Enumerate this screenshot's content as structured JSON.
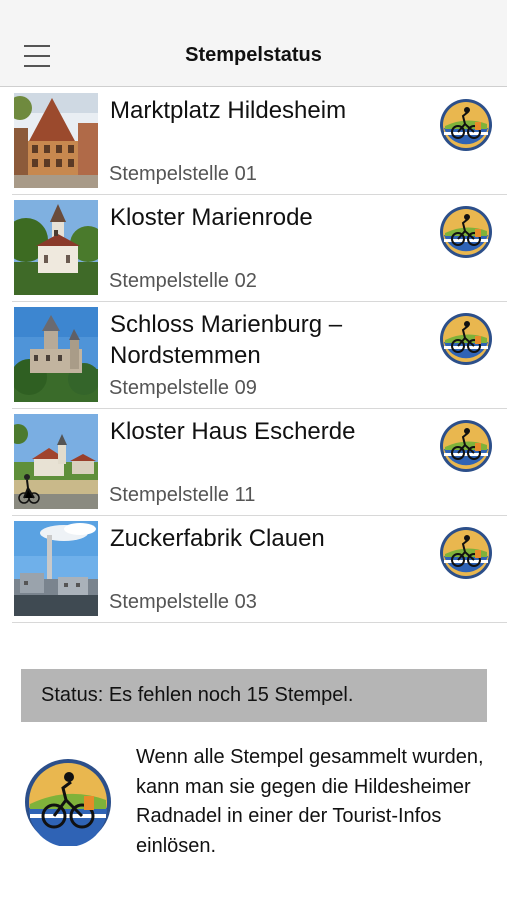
{
  "navbar": {
    "title": "Stempelstatus",
    "menu_icon": "hamburger-menu-icon"
  },
  "stations": [
    {
      "title": "Marktplatz Hildesheim",
      "subtitle": "Stempelstelle 01",
      "image": "half-timbered-market-square"
    },
    {
      "title": "Kloster Marienrode",
      "subtitle": "Stempelstelle 02",
      "image": "monastery-church"
    },
    {
      "title": "Schloss Marienburg – Nordstemmen",
      "subtitle": "Stempelstelle 09",
      "image": "castle-on-hill"
    },
    {
      "title": "Kloster Haus Escherde",
      "subtitle": "Stempelstelle 11",
      "image": "village-with-cyclist"
    },
    {
      "title": "Zuckerfabrik Clauen",
      "subtitle": "Stempelstelle 03",
      "image": "sugar-factory-chimney"
    }
  ],
  "stamp_icon": "cyclist-stamp-icon",
  "status": {
    "text": "Status: Es fehlen noch 15 Stempel."
  },
  "footer": {
    "text": "Wenn alle Stempel gesammelt wurden, kann man sie gegen die Hildesheimer Radnadel in einer der Tourist-Infos einlösen.",
    "logo_icon": "radnadel-badge-icon"
  },
  "colors": {
    "navbar_bg": "#f5f5f5",
    "status_bg": "#b5b5b5",
    "badge_gold": "#d9a443",
    "badge_blue": "#2f63b5",
    "badge_green": "#7fb23a"
  }
}
